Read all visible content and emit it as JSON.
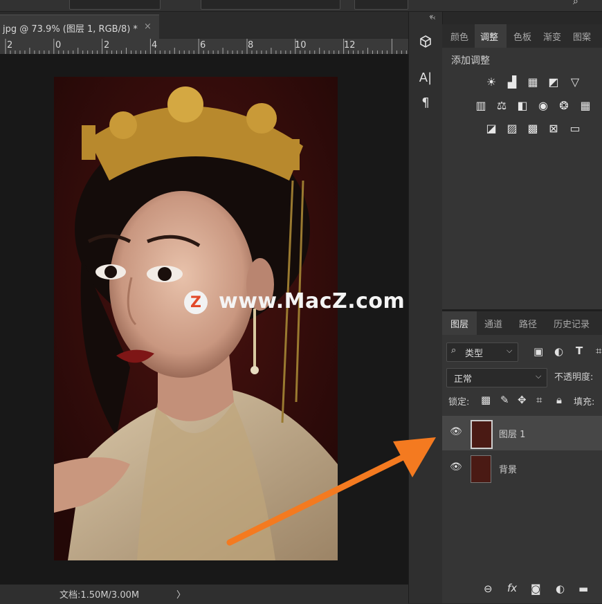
{
  "document_tab": {
    "title": "jpg @ 73.9% (图层 1, RGB/8) *",
    "close_glyph": "×"
  },
  "ruler": {
    "ticks": [
      "2",
      "0",
      "2",
      "4",
      "6",
      "8",
      "10",
      "12"
    ]
  },
  "status_bar": {
    "doc_size": "文档:1.50M/3.00M",
    "menu_glyph": "〉"
  },
  "tool_column": {
    "collapse_glyph": "‹‹",
    "text_tool": "A|",
    "paragraph_tool": "¶"
  },
  "adjustments_panel": {
    "tabs": [
      {
        "label": "颜色",
        "active": false
      },
      {
        "label": "调整",
        "active": true
      },
      {
        "label": "色板",
        "active": false
      },
      {
        "label": "渐变",
        "active": false
      },
      {
        "label": "图案",
        "active": false
      }
    ],
    "title": "添加调整",
    "icons": {
      "brightness": "☀",
      "levels": "▟",
      "curves": "▦",
      "exposure": "◩",
      "vibrance": "▽",
      "hue": "▥",
      "balance": "⚖",
      "bw": "◧",
      "photo_filter": "◉",
      "mixer": "❂",
      "lookup": "▦",
      "invert": "◪",
      "posterize": "▨",
      "threshold": "▩",
      "selective": "⊠",
      "gradient_map": "▭"
    }
  },
  "layers_panel": {
    "tabs": [
      {
        "label": "图层",
        "active": true
      },
      {
        "label": "通道",
        "active": false
      },
      {
        "label": "路径",
        "active": false
      },
      {
        "label": "历史记录",
        "active": false
      }
    ],
    "filter_label": "类型",
    "blend_mode": "正常",
    "opacity_label": "不透明度:",
    "lock_label": "锁定:",
    "fill_label": "填充:",
    "layers": [
      {
        "name": "图层 1",
        "selected": true
      },
      {
        "name": "背景",
        "selected": false
      }
    ],
    "footer": {
      "link": "⊖",
      "fx": "fx",
      "mask": "◙",
      "adjust": "◐",
      "folder": "▬"
    }
  },
  "watermark": {
    "logo_letter": "Z",
    "text": "www.MacZ.com"
  },
  "colors": {
    "accent_arrow": "#f47a20",
    "panel_bg": "#353535",
    "canvas_bg": "#181818"
  }
}
